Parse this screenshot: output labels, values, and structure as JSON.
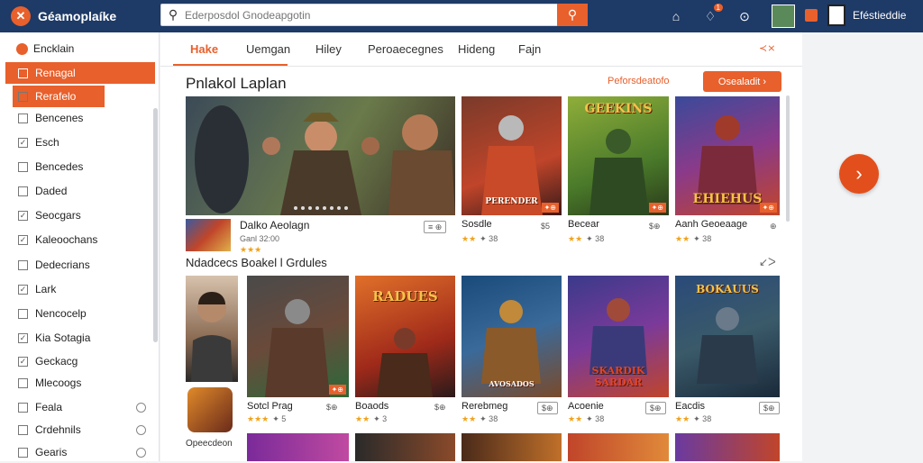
{
  "header": {
    "app_title": "Géamoplaíke",
    "search_placeholder": "Ederposdol Gnodeapgotin",
    "notification_count": "1",
    "user_name": "Eféstieddie"
  },
  "sidebar": {
    "items": [
      {
        "label": "Encklain"
      },
      {
        "label": "Renagal"
      },
      {
        "label": "Rerafelo"
      },
      {
        "label": "Bencenes"
      },
      {
        "label": "Esch"
      },
      {
        "label": "Bencedes"
      },
      {
        "label": "Daded"
      },
      {
        "label": "Seocgars"
      },
      {
        "label": "Kaleoochans"
      },
      {
        "label": "Dedecrians"
      },
      {
        "label": "Lark"
      },
      {
        "label": "Nencocelp"
      },
      {
        "label": "Kia Sotagia"
      },
      {
        "label": "Geckacg"
      },
      {
        "label": "Mlecoogs"
      },
      {
        "label": "Feala"
      },
      {
        "label": "Crdehnils"
      },
      {
        "label": "Gearis"
      }
    ]
  },
  "tabs": [
    {
      "label": "Hake"
    },
    {
      "label": "Uemgan"
    },
    {
      "label": "Hiley"
    },
    {
      "label": "Peroaecegnes"
    },
    {
      "label": "Hideng"
    },
    {
      "label": "Fajn"
    }
  ],
  "tab_more": "≺⨯",
  "section": {
    "title": "Pnlakol Laplan",
    "recommend": "Peforsdeatofo",
    "button": "Osealadit"
  },
  "featured": {
    "title": "Dalko Aeolagn",
    "stars": "★★★",
    "rating": "Ganl 32:00",
    "pill": "≡ ⊕"
  },
  "top_cards": [
    {
      "title": "Sosdle",
      "stars": "★★",
      "rating": "✦ 38",
      "tag": "✦⊕",
      "pill": "$5"
    },
    {
      "title": "Becear",
      "stars": "★★",
      "rating": "✦ 38",
      "tag": "✦⊕",
      "pill": "$⊕"
    },
    {
      "title": "Aanh Geoeaage",
      "stars": "★★",
      "rating": "✦ 38",
      "tag": "✦⊕",
      "pill": "⊕"
    }
  ],
  "banner_texts": [
    "GEEKINS",
    "PERENDER",
    "EHIEHUS"
  ],
  "row2": {
    "title": "Ndadcecs Boakel l Grdules",
    "more": "↙ᐳ",
    "side_caption": "Opeecdeon",
    "cards": [
      {
        "title": "Sotcl Prag",
        "stars": "★★★",
        "rating": "✦ 5",
        "tag": "✦⊕",
        "pill": "$⊕"
      },
      {
        "title": "Boaods",
        "stars": "★★",
        "rating": "✦ 3",
        "pill": "$⊕",
        "banner": "RADUES"
      },
      {
        "title": "Rerebmeg",
        "stars": "★★",
        "rating": "✦ 38",
        "pill": "$⊕",
        "banner": "AVOSADOS"
      },
      {
        "title": "Acoenie",
        "stars": "★★",
        "rating": "✦ 38",
        "pill": "$⊕",
        "banner": "SKARDIK SARDAR"
      },
      {
        "title": "Eacdis",
        "stars": "★★",
        "rating": "✦ 38",
        "pill": "$⊕",
        "banner": "BOKAUUS"
      }
    ]
  },
  "colors": {
    "accent": "#e8602c",
    "header": "#1e3a66"
  }
}
